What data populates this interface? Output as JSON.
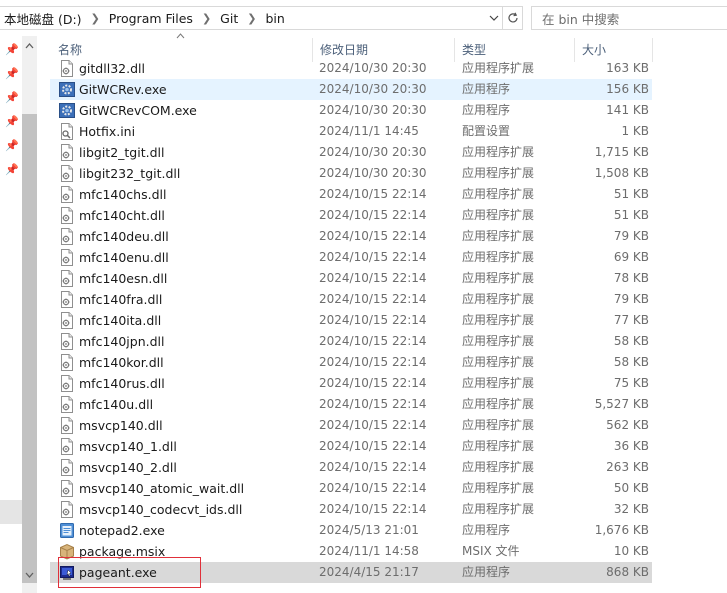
{
  "address": {
    "crumbs": [
      "本地磁盘 (D:)",
      "Program Files",
      "Git",
      "bin"
    ],
    "search_placeholder": "在 bin 中搜索"
  },
  "columns": {
    "name": "名称",
    "date": "修改日期",
    "type": "类型",
    "size": "大小"
  },
  "files": [
    {
      "name": "gitdll32.dll",
      "date": "2024/10/30 20:30",
      "type": "应用程序扩展",
      "size": "163 KB",
      "icon": "dll-icon"
    },
    {
      "name": "GitWCRev.exe",
      "date": "2024/10/30 20:30",
      "type": "应用程序",
      "size": "156 KB",
      "icon": "exe-gear-icon"
    },
    {
      "name": "GitWCRevCOM.exe",
      "date": "2024/10/30 20:30",
      "type": "应用程序",
      "size": "141 KB",
      "icon": "exe-gear-icon"
    },
    {
      "name": "Hotfix.ini",
      "date": "2024/11/1 14:45",
      "type": "配置设置",
      "size": "1 KB",
      "icon": "ini-icon"
    },
    {
      "name": "libgit2_tgit.dll",
      "date": "2024/10/30 20:30",
      "type": "应用程序扩展",
      "size": "1,715 KB",
      "icon": "dll-icon"
    },
    {
      "name": "libgit232_tgit.dll",
      "date": "2024/10/30 20:30",
      "type": "应用程序扩展",
      "size": "1,508 KB",
      "icon": "dll-icon"
    },
    {
      "name": "mfc140chs.dll",
      "date": "2024/10/15 22:14",
      "type": "应用程序扩展",
      "size": "51 KB",
      "icon": "dll-icon"
    },
    {
      "name": "mfc140cht.dll",
      "date": "2024/10/15 22:14",
      "type": "应用程序扩展",
      "size": "51 KB",
      "icon": "dll-icon"
    },
    {
      "name": "mfc140deu.dll",
      "date": "2024/10/15 22:14",
      "type": "应用程序扩展",
      "size": "79 KB",
      "icon": "dll-icon"
    },
    {
      "name": "mfc140enu.dll",
      "date": "2024/10/15 22:14",
      "type": "应用程序扩展",
      "size": "69 KB",
      "icon": "dll-icon"
    },
    {
      "name": "mfc140esn.dll",
      "date": "2024/10/15 22:14",
      "type": "应用程序扩展",
      "size": "78 KB",
      "icon": "dll-icon"
    },
    {
      "name": "mfc140fra.dll",
      "date": "2024/10/15 22:14",
      "type": "应用程序扩展",
      "size": "79 KB",
      "icon": "dll-icon"
    },
    {
      "name": "mfc140ita.dll",
      "date": "2024/10/15 22:14",
      "type": "应用程序扩展",
      "size": "77 KB",
      "icon": "dll-icon"
    },
    {
      "name": "mfc140jpn.dll",
      "date": "2024/10/15 22:14",
      "type": "应用程序扩展",
      "size": "58 KB",
      "icon": "dll-icon"
    },
    {
      "name": "mfc140kor.dll",
      "date": "2024/10/15 22:14",
      "type": "应用程序扩展",
      "size": "58 KB",
      "icon": "dll-icon"
    },
    {
      "name": "mfc140rus.dll",
      "date": "2024/10/15 22:14",
      "type": "应用程序扩展",
      "size": "75 KB",
      "icon": "dll-icon"
    },
    {
      "name": "mfc140u.dll",
      "date": "2024/10/15 22:14",
      "type": "应用程序扩展",
      "size": "5,527 KB",
      "icon": "dll-icon"
    },
    {
      "name": "msvcp140.dll",
      "date": "2024/10/15 22:14",
      "type": "应用程序扩展",
      "size": "562 KB",
      "icon": "dll-icon"
    },
    {
      "name": "msvcp140_1.dll",
      "date": "2024/10/15 22:14",
      "type": "应用程序扩展",
      "size": "36 KB",
      "icon": "dll-icon"
    },
    {
      "name": "msvcp140_2.dll",
      "date": "2024/10/15 22:14",
      "type": "应用程序扩展",
      "size": "263 KB",
      "icon": "dll-icon"
    },
    {
      "name": "msvcp140_atomic_wait.dll",
      "date": "2024/10/15 22:14",
      "type": "应用程序扩展",
      "size": "50 KB",
      "icon": "dll-icon"
    },
    {
      "name": "msvcp140_codecvt_ids.dll",
      "date": "2024/10/15 22:14",
      "type": "应用程序扩展",
      "size": "32 KB",
      "icon": "dll-icon"
    },
    {
      "name": "notepad2.exe",
      "date": "2024/5/13 21:01",
      "type": "应用程序",
      "size": "1,676 KB",
      "icon": "notepad-icon"
    },
    {
      "name": "package.msix",
      "date": "2024/11/1 14:58",
      "type": "MSIX 文件",
      "size": "10 KB",
      "icon": "package-icon"
    },
    {
      "name": "pageant.exe",
      "date": "2024/4/15 21:17",
      "type": "应用程序",
      "size": "868 KB",
      "icon": "pageant-icon"
    }
  ],
  "state": {
    "hover_row": 1,
    "selected_row": 24,
    "highlighted_row": 24
  },
  "colors": {
    "hover": "#e5f3ff",
    "selected": "#d9d9d9",
    "highlight_border": "#e0303a",
    "header_text": "#4c607a"
  }
}
